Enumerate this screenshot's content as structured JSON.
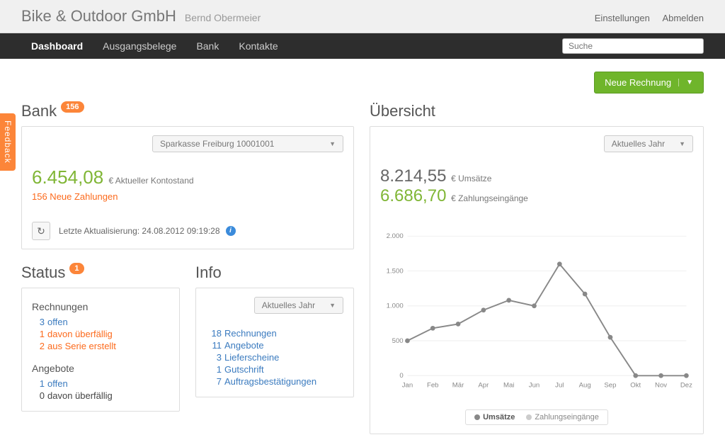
{
  "header": {
    "company": "Bike & Outdoor GmbH",
    "user": "Bernd Obermeier",
    "settings": "Einstellungen",
    "logout": "Abmelden"
  },
  "nav": {
    "dashboard": "Dashboard",
    "outgoing": "Ausgangsbelege",
    "bank": "Bank",
    "contacts": "Kontakte",
    "search_placeholder": "Suche"
  },
  "action": {
    "new_invoice": "Neue Rechnung"
  },
  "feedback": "Feedback",
  "bank": {
    "title": "Bank",
    "badge": "156",
    "dropdown": "Sparkasse Freiburg 10001001",
    "balance": "6.454,08",
    "balance_suffix": "€ Aktueller Kontostand",
    "new_payments": "156 Neue Zahlungen",
    "last_update_label": "Letzte Aktualisierung:",
    "last_update_value": "24.08.2012 09:19:28"
  },
  "status": {
    "title": "Status",
    "badge": "1",
    "invoices_heading": "Rechnungen",
    "inv_open_n": "3",
    "inv_open_t": "offen",
    "inv_over_n": "1",
    "inv_over_t": "davon überfällig",
    "inv_ser_n": "2",
    "inv_ser_t": "aus Serie erstellt",
    "offers_heading": "Angebote",
    "off_open_n": "1",
    "off_open_t": "offen",
    "off_over_n": "0",
    "off_over_t": "davon überfällig"
  },
  "info": {
    "title": "Info",
    "dropdown": "Aktuelles Jahr",
    "items": [
      {
        "n": "18",
        "t": "Rechnungen"
      },
      {
        "n": "11",
        "t": "Angebote"
      },
      {
        "n": "3",
        "t": "Lieferscheine"
      },
      {
        "n": "1",
        "t": "Gutschrift"
      },
      {
        "n": "7",
        "t": "Auftragsbestätigungen"
      }
    ]
  },
  "overview": {
    "title": "Übersicht",
    "dropdown": "Aktuelles Jahr",
    "rev_amount": "8.214,55",
    "rev_suffix": "€ Umsätze",
    "pay_amount": "6.686,70",
    "pay_suffix": "€ Zahlungseingänge",
    "legend_rev": "Umsätze",
    "legend_pay": "Zahlungseingänge"
  },
  "chart_data": {
    "type": "line",
    "categories": [
      "Jan",
      "Feb",
      "Mär",
      "Apr",
      "Mai",
      "Jun",
      "Jul",
      "Aug",
      "Sep",
      "Okt",
      "Nov",
      "Dez"
    ],
    "series": [
      {
        "name": "Umsätze",
        "values": [
          500,
          680,
          740,
          940,
          1080,
          1000,
          1600,
          1170,
          550,
          0,
          0,
          0
        ]
      }
    ],
    "ylabel": "",
    "xlabel": "",
    "ylim": [
      0,
      2000
    ],
    "yticks": [
      0,
      500,
      1000,
      1500,
      2000
    ]
  }
}
